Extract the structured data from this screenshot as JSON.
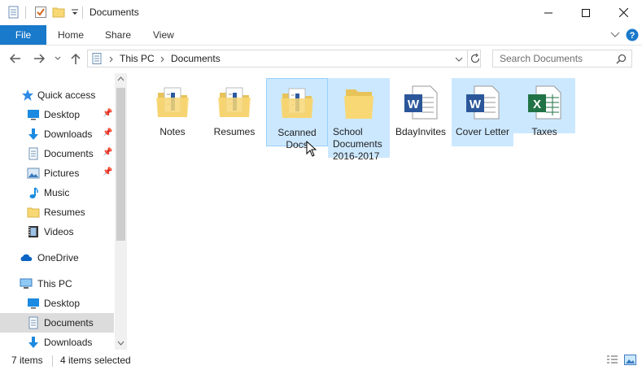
{
  "window": {
    "title": "Documents"
  },
  "ribbon": {
    "tabs": [
      "File",
      "Home",
      "Share",
      "View"
    ]
  },
  "address": {
    "path": [
      "This PC",
      "Documents"
    ],
    "search_placeholder": "Search Documents"
  },
  "nav": {
    "items": [
      {
        "label": "Quick access",
        "icon": "star-icon"
      },
      {
        "label": "Desktop",
        "icon": "desktop-icon",
        "pinned": true
      },
      {
        "label": "Downloads",
        "icon": "download-icon",
        "pinned": true
      },
      {
        "label": "Documents",
        "icon": "document-icon",
        "pinned": true
      },
      {
        "label": "Pictures",
        "icon": "pictures-icon",
        "pinned": true
      },
      {
        "label": "Music",
        "icon": "music-icon"
      },
      {
        "label": "Resumes",
        "icon": "folder-icon"
      },
      {
        "label": "Videos",
        "icon": "video-icon"
      },
      {
        "label": "OneDrive",
        "icon": "cloud-icon"
      },
      {
        "label": "This PC",
        "icon": "computer-icon"
      },
      {
        "label": "Desktop",
        "icon": "desktop-icon"
      },
      {
        "label": "Documents",
        "icon": "document-icon"
      },
      {
        "label": "Downloads",
        "icon": "download-icon"
      }
    ]
  },
  "files": [
    {
      "name": "Notes",
      "type": "folder-docs",
      "selected": false
    },
    {
      "name": "Resumes",
      "type": "folder-docs",
      "selected": false
    },
    {
      "name": "Scanned Docs",
      "type": "folder-docs",
      "selected": true
    },
    {
      "name": "School Documents 2016-2017",
      "type": "folder",
      "selected": true
    },
    {
      "name": "BdayInvites",
      "type": "word",
      "selected": false
    },
    {
      "name": "Cover Letter",
      "type": "word",
      "selected": true
    },
    {
      "name": "Taxes",
      "type": "excel",
      "selected": true
    }
  ],
  "status": {
    "item_count": "7 items",
    "selected_count": "4 items selected"
  },
  "colors": {
    "file_tab": "#1979ca",
    "selection": "#cce8ff",
    "word": "#2b579a",
    "excel": "#217346",
    "folder": "#f8d775"
  }
}
